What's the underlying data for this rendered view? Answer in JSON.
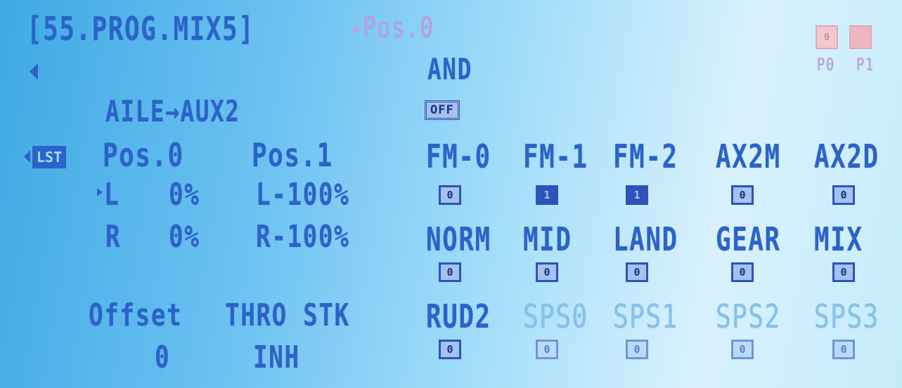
{
  "header": {
    "title": "[55.PROG.MIX5]",
    "position": "Pos.0"
  },
  "top_right": {
    "p0_label": "P0",
    "p1_label": "P1",
    "p0_value": "0",
    "p1_value": ""
  },
  "mix": {
    "name": "AILE→AUX2",
    "logic": "AND",
    "logic_switch": "OFF",
    "list_button": "LST",
    "col_pos0": "Pos.0",
    "col_pos1": "Pos.1",
    "row_l_label": "L",
    "row_l_pos0": "0%",
    "row_l_pos1": "L-100%",
    "row_r_label": "R",
    "row_r_pos0": "0%",
    "row_r_pos1": "R-100%",
    "offset_label": "Offset",
    "offset_value": "0",
    "source_label": "THRO STK",
    "source_value": "INH"
  },
  "switches": [
    {
      "label": "FM-0",
      "value": "0",
      "state": "off"
    },
    {
      "label": "FM-1",
      "value": "1",
      "state": "on"
    },
    {
      "label": "FM-2",
      "value": "1",
      "state": "on"
    },
    {
      "label": "AX2M",
      "value": "0",
      "state": "off"
    },
    {
      "label": "AX2D",
      "value": "0",
      "state": "off"
    },
    {
      "label": "NORM",
      "value": "0",
      "state": "off"
    },
    {
      "label": "MID",
      "value": "0",
      "state": "off"
    },
    {
      "label": "LAND",
      "value": "0",
      "state": "off"
    },
    {
      "label": "GEAR",
      "value": "0",
      "state": "off"
    },
    {
      "label": "MIX",
      "value": "0",
      "state": "off"
    },
    {
      "label": "RUD2",
      "value": "0",
      "state": "off"
    },
    {
      "label": "SPS0",
      "value": "0",
      "state": "dim"
    },
    {
      "label": "SPS1",
      "value": "0",
      "state": "dim"
    },
    {
      "label": "SPS2",
      "value": "0",
      "state": "dim"
    },
    {
      "label": "SPS3",
      "value": "0",
      "state": "dim"
    }
  ],
  "colors": {
    "lcd_text": "#2b63c8",
    "lcd_bg": "#6cc2f2",
    "dim_text": "#86c2ea",
    "pink": "#efb6c0"
  }
}
